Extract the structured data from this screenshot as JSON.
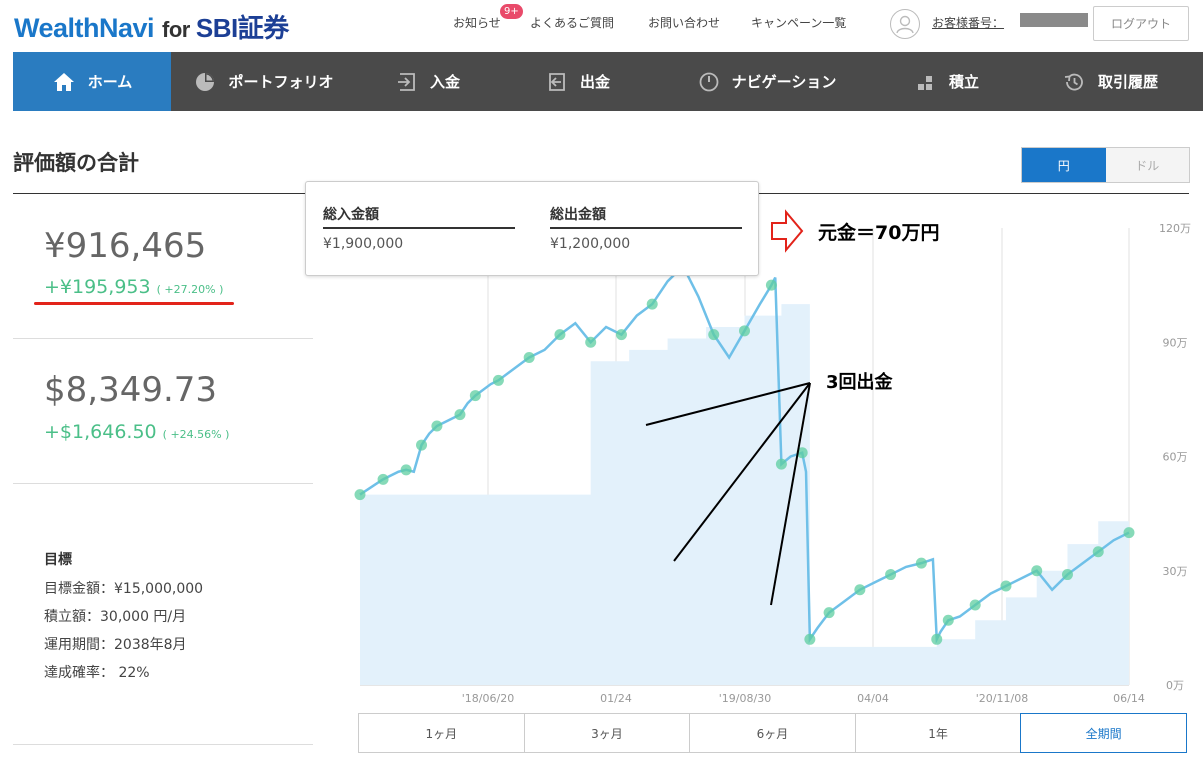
{
  "header": {
    "logo_main": "WealthNavi",
    "logo_for": "for",
    "logo_partner": "SBI証券",
    "links": [
      "お知らせ",
      "よくあるご質問",
      "お問い合わせ",
      "キャンペーン一覧"
    ],
    "badge": "9+",
    "customer_label": "お客様番号：",
    "logout": "ログアウト"
  },
  "nav": [
    {
      "label": "ホーム",
      "icon": "home-icon",
      "active": true
    },
    {
      "label": "ポートフォリオ",
      "icon": "pie-chart-icon",
      "active": false
    },
    {
      "label": "入金",
      "icon": "deposit-icon",
      "active": false
    },
    {
      "label": "出金",
      "icon": "withdraw-icon",
      "active": false
    },
    {
      "label": "ナビゲーション",
      "icon": "navigation-icon",
      "active": false
    },
    {
      "label": "積立",
      "icon": "accumulate-icon",
      "active": false
    },
    {
      "label": "取引履歴",
      "icon": "history-icon",
      "active": false
    }
  ],
  "summary": {
    "title": "評価額の合計",
    "currency": [
      "円",
      "ドル"
    ],
    "jpy_value": "¥916,465",
    "jpy_gain": "+¥195,953",
    "jpy_gain_pct": "( +27.20% )",
    "usd_value": "$8,349.73",
    "usd_gain": "+$1,646.50",
    "usd_gain_pct": "( +24.56% )"
  },
  "goal": {
    "title": "目標",
    "rows": [
      "目標金額：¥15,000,000",
      "積立額：30,000 円/月",
      "運用期間：2038年8月",
      "達成確率： 22%"
    ]
  },
  "tooltip": {
    "deposit_label": "総入金額",
    "deposit_value": "¥1,900,000",
    "withdraw_label": "総出金額",
    "withdraw_value": "¥1,200,000"
  },
  "annotations": {
    "principal": "元金＝70万円",
    "withdrawals": "3回出金"
  },
  "periods": [
    {
      "label": "1ヶ月",
      "active": false
    },
    {
      "label": "3ヶ月",
      "active": false
    },
    {
      "label": "6ヶ月",
      "active": false
    },
    {
      "label": "1年",
      "active": false
    },
    {
      "label": "全期間",
      "active": true
    }
  ],
  "colors": {
    "accent": "#1a77c9",
    "gain": "#4bbf88",
    "line": "#6fc0e8",
    "area": "#e3f1fb",
    "nav": "#4a4a4a"
  },
  "chart_data": {
    "type": "area",
    "x_tick_labels": [
      "'18/06/20",
      "01/24",
      "'19/08/30",
      "04/04",
      "'20/11/08",
      "06/14"
    ],
    "y_tick_labels": [
      "0万",
      "30万",
      "60万",
      "90万",
      "120万"
    ],
    "ylim": [
      0,
      1200000
    ],
    "x_index_range": [
      0,
      100
    ],
    "grid": true,
    "series": [
      {
        "role": "evaluation",
        "x": [
          0,
          1.5,
          3,
          5,
          6,
          7,
          8,
          9,
          10,
          11,
          13,
          14,
          15,
          17,
          18,
          20,
          22,
          24,
          26,
          28,
          30,
          32,
          34,
          36,
          38,
          40,
          42,
          44,
          46,
          48,
          50,
          52,
          53.5,
          54,
          54.8,
          56,
          57.5,
          58,
          58.5,
          59.5,
          61,
          63,
          65,
          67,
          69,
          71,
          73,
          74.5,
          75,
          75.5,
          76.5,
          78,
          80,
          82,
          84,
          86,
          88,
          90,
          92,
          94,
          96,
          98,
          100
        ],
        "y": [
          500000,
          520000,
          540000,
          560000,
          565000,
          560000,
          630000,
          660000,
          680000,
          690000,
          710000,
          740000,
          760000,
          790000,
          800000,
          830000,
          860000,
          880000,
          920000,
          950000,
          900000,
          940000,
          920000,
          970000,
          1000000,
          1060000,
          1100000,
          1020000,
          920000,
          860000,
          930000,
          1000000,
          1050000,
          1070000,
          580000,
          600000,
          610000,
          560000,
          120000,
          150000,
          190000,
          220000,
          250000,
          270000,
          290000,
          310000,
          320000,
          330000,
          120000,
          140000,
          170000,
          180000,
          210000,
          240000,
          260000,
          280000,
          300000,
          250000,
          290000,
          320000,
          350000,
          380000,
          400000
        ]
      },
      {
        "role": "principal",
        "x": [
          0,
          30,
          35,
          40,
          45,
          50,
          54.8,
          58.5,
          75,
          80,
          84,
          88,
          92,
          96,
          100
        ],
        "y": [
          500000,
          850000,
          880000,
          910000,
          940000,
          970000,
          1000000,
          100000,
          120000,
          170000,
          230000,
          300000,
          370000,
          430000,
          480000
        ]
      }
    ]
  }
}
